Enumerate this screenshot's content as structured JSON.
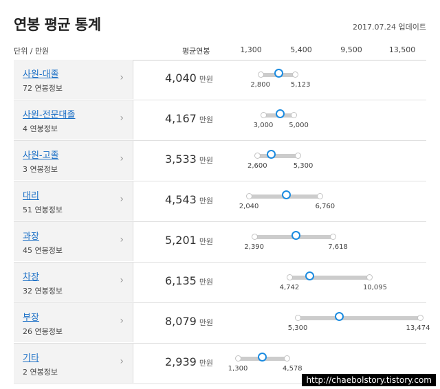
{
  "page": {
    "title": "연봉 평균 통계",
    "updated": "2017.07.24 업데이트",
    "unit_label": "단위 / 만원",
    "avg_label": "평균연봉",
    "watermark": "http://chaebolstory.tistory.com"
  },
  "chart_data": {
    "type": "range",
    "scale_ticks": [
      "1,300",
      "5,400",
      "9,500",
      "13,500"
    ],
    "scale_values": [
      1300,
      5400,
      9500,
      13500
    ],
    "unit": "만원",
    "rows": [
      {
        "name": "사원-대졸",
        "info": "72 연봉정보",
        "avg": 4040,
        "avg_text": "4,040",
        "min": 2800,
        "max": 5123,
        "min_text": "2,800",
        "max_text": "5,123"
      },
      {
        "name": "사원-전문대졸",
        "info": "4 연봉정보",
        "avg": 4167,
        "avg_text": "4,167",
        "min": 3000,
        "max": 5000,
        "min_text": "3,000",
        "max_text": "5,000"
      },
      {
        "name": "사원-고졸",
        "info": "3 연봉정보",
        "avg": 3533,
        "avg_text": "3,533",
        "min": 2600,
        "max": 5300,
        "min_text": "2,600",
        "max_text": "5,300"
      },
      {
        "name": "대리",
        "info": "51 연봉정보",
        "avg": 4543,
        "avg_text": "4,543",
        "min": 2040,
        "max": 6760,
        "min_text": "2,040",
        "max_text": "6,760"
      },
      {
        "name": "과장",
        "info": "45 연봉정보",
        "avg": 5201,
        "avg_text": "5,201",
        "min": 2390,
        "max": 7618,
        "min_text": "2,390",
        "max_text": "7,618"
      },
      {
        "name": "차장",
        "info": "32 연봉정보",
        "avg": 6135,
        "avg_text": "6,135",
        "min": 4742,
        "max": 10095,
        "min_text": "4,742",
        "max_text": "10,095"
      },
      {
        "name": "부장",
        "info": "26 연봉정보",
        "avg": 8079,
        "avg_text": "8,079",
        "min": 5300,
        "max": 13474,
        "min_text": "5,300",
        "max_text": "13,474"
      },
      {
        "name": "기타",
        "info": "2 연봉정보",
        "avg": 2939,
        "avg_text": "2,939",
        "min": 1300,
        "max": 4578,
        "min_text": "1,300",
        "max_text": "4,578"
      }
    ]
  },
  "colors": {
    "accent": "#1b8be0",
    "link": "#1a6fc6",
    "bar": "#cccccc"
  }
}
